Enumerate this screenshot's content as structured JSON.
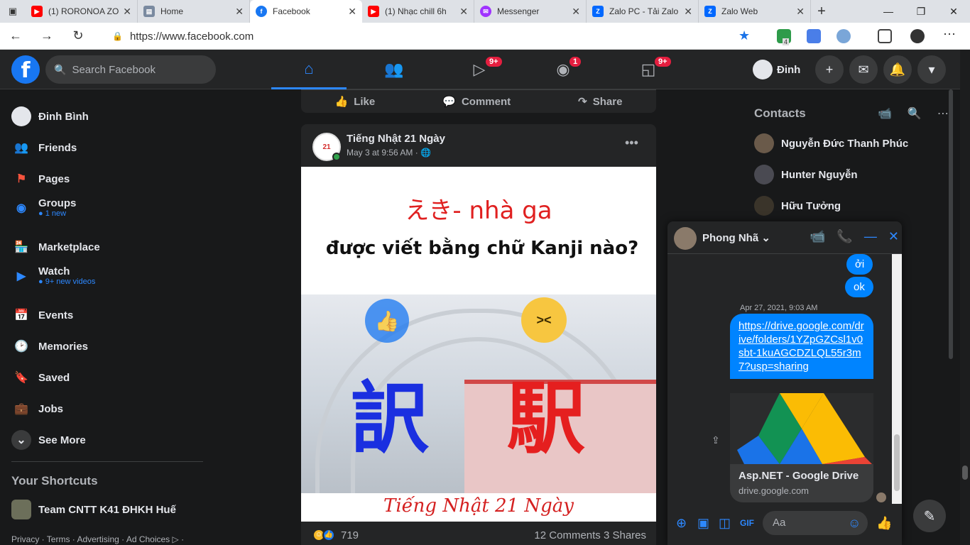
{
  "browser": {
    "tabs": [
      {
        "label": "(1) RORONOA ZO",
        "color": "#ff0000",
        "glyph": "▶"
      },
      {
        "label": "Home",
        "color": "#7a8aa0",
        "glyph": "▤"
      },
      {
        "label": "Facebook",
        "color": "#1877f2",
        "glyph": "f"
      },
      {
        "label": "(1) Nhạc chill 6h",
        "color": "#ff0000",
        "glyph": "▶"
      },
      {
        "label": "Messenger",
        "color": "#a033ff",
        "glyph": "✉"
      },
      {
        "label": "Zalo PC - Tải Zalo",
        "color": "#0068ff",
        "glyph": "Z"
      },
      {
        "label": "Zalo Web",
        "color": "#0068ff",
        "glyph": "Z"
      }
    ],
    "url": "https://www.facebook.com",
    "ext_badge": "4"
  },
  "header": {
    "search_placeholder": "Search Facebook",
    "badges": {
      "watch": "9+",
      "groups": "1",
      "gaming": "9+"
    },
    "profile_name": "Đinh"
  },
  "sidebar": {
    "items": [
      {
        "label": "Đinh Bình",
        "sub": ""
      },
      {
        "label": "Friends",
        "sub": ""
      },
      {
        "label": "Pages",
        "sub": ""
      },
      {
        "label": "Groups",
        "sub": "● 1 new"
      },
      {
        "label": "Marketplace",
        "sub": ""
      },
      {
        "label": "Watch",
        "sub": "● 9+ new videos"
      },
      {
        "label": "Events",
        "sub": ""
      },
      {
        "label": "Memories",
        "sub": ""
      },
      {
        "label": "Saved",
        "sub": ""
      },
      {
        "label": "Jobs",
        "sub": ""
      },
      {
        "label": "See More",
        "sub": ""
      }
    ],
    "shortcuts_title": "Your Shortcuts",
    "shortcut": "Team CNTT K41 ĐHKH Huế",
    "footer": "Privacy · Terms · Advertising · Ad Choices ▷ ·"
  },
  "prev_post": {
    "like": "Like",
    "comment": "Comment",
    "share": "Share"
  },
  "post": {
    "author": "Tiếng Nhật 21 Ngày",
    "time": "May 3 at 9:56 AM · 🌐",
    "image": {
      "line1": "えき- nhà ga",
      "line2": "được viết bằng chữ Kanji nào?",
      "kanji_left": "訳",
      "kanji_right": "駅",
      "brand": "Tiếng Nhật 21 Ngày"
    },
    "reactions": "719",
    "comments_shares": "12 Comments  3 Shares"
  },
  "contacts": {
    "title": "Contacts",
    "list": [
      "Nguyễn Đức Thanh Phúc",
      "Hunter Nguyễn",
      "Hữu Tưởng"
    ]
  },
  "chat": {
    "name": "Phong Nhã",
    "msg1": "ởi",
    "msg2": "ok",
    "timestamp": "Apr 27, 2021, 9:03 AM",
    "link": "https://drive.google.com/drive/folders/1YZpGZCsl1v0sbt-1kuAGCDZLQL55r3m7?usp=sharing",
    "preview_title": "Asp.NET - Google Drive",
    "preview_host": "drive.google.com",
    "input_placeholder": "Aa"
  }
}
